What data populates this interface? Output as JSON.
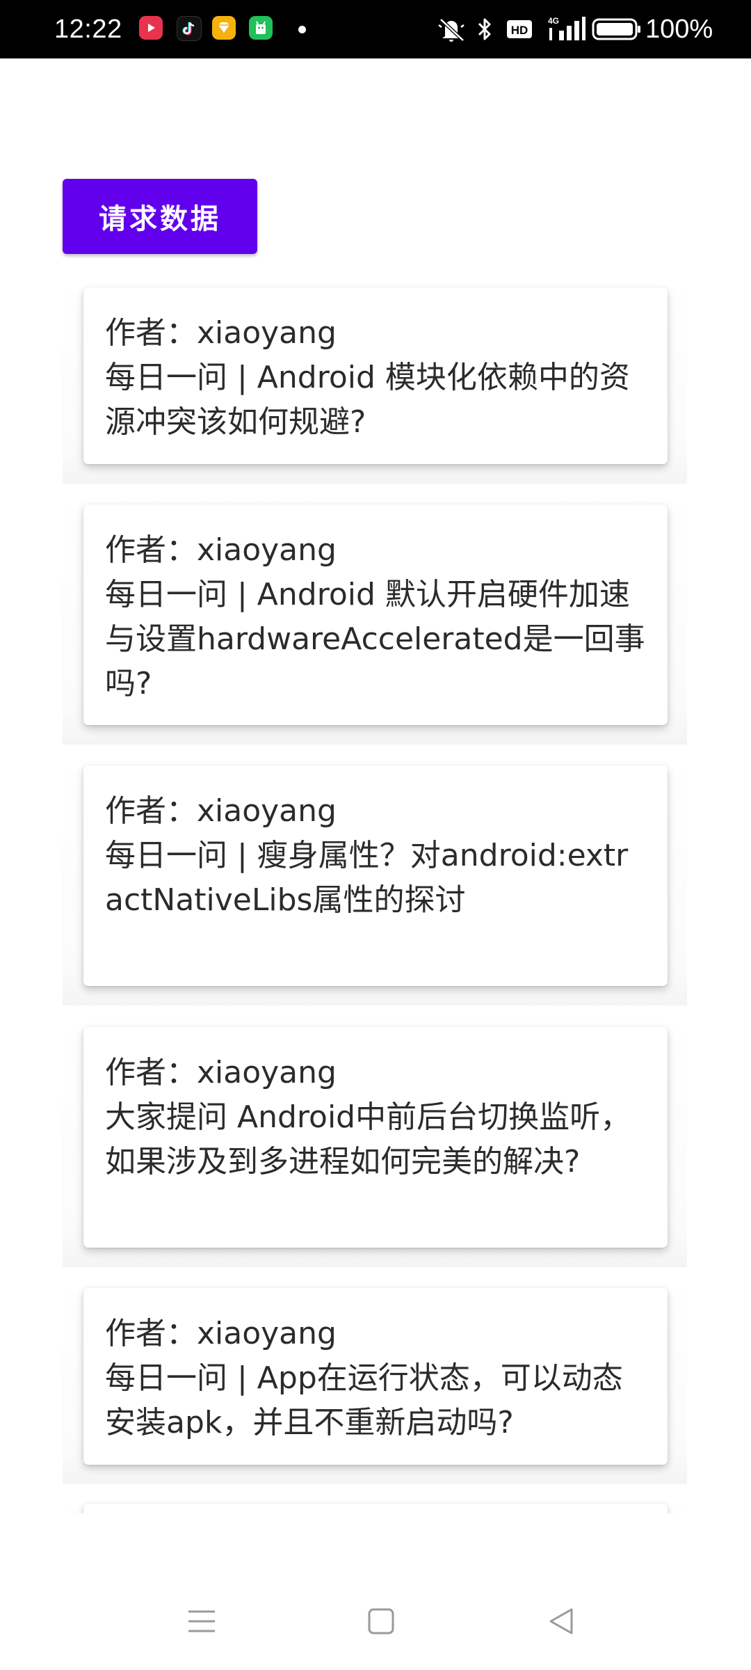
{
  "status_bar": {
    "time": "12:22",
    "battery_text": "100%",
    "hd_label": "HD",
    "network_label": "4G",
    "notification_icons": [
      "video-app-icon",
      "tiktok-icon",
      "yellow-app-icon",
      "green-app-icon"
    ],
    "system_icons": [
      "mute-icon",
      "bluetooth-icon",
      "hd-icon",
      "signal-icon",
      "battery-icon"
    ]
  },
  "request_button": {
    "label": "请求数据"
  },
  "articles": [
    {
      "author": "作者：xiaoyang",
      "title": "每日一问 | Android 模块化依赖中的资源冲突该如何规避?"
    },
    {
      "author": "作者：xiaoyang",
      "title": "每日一问 | Android 默认开启硬件加速与设置hardwareAccelerated是一回事吗?"
    },
    {
      "author": "作者：xiaoyang",
      "title": "每日一问 | 瘦身属性？对android:extractNativeLibs属性的探讨"
    },
    {
      "author": "作者：xiaoyang",
      "title": "大家提问 Android中前后台切换监听，如果涉及到多进程如何完美的解决?"
    },
    {
      "author": "作者：xiaoyang",
      "title": "每日一问 | App在运行状态，可以动态安装apk，并且不重新启动吗?"
    }
  ],
  "nav_bar": {
    "buttons": [
      "menu-icon",
      "home-icon",
      "back-icon"
    ]
  },
  "colors": {
    "accent": "#6200ee",
    "status_bar_bg": "#000000",
    "text": "#2b2b2b",
    "background": "#ffffff"
  }
}
